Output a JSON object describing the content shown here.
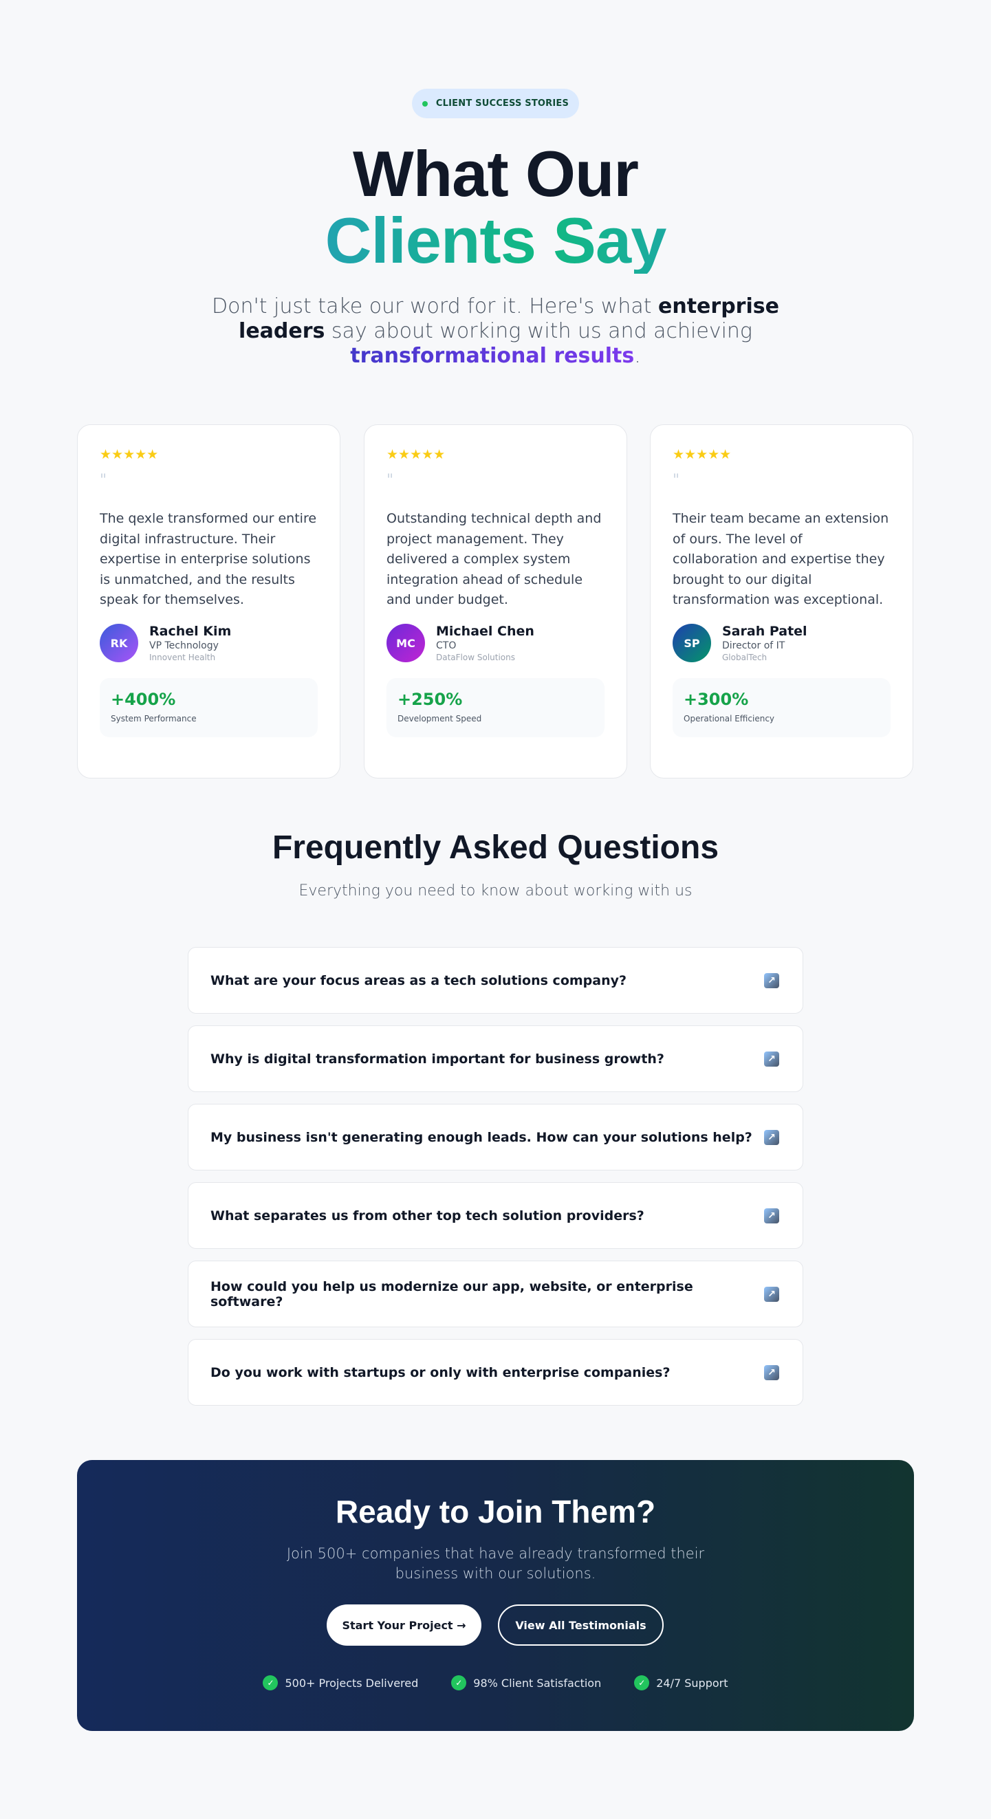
{
  "hero": {
    "badge": "CLIENT SUCCESS STORIES",
    "title_line1": "What Our",
    "title_line2": "Clients Say",
    "subtitle_pre": "Don't just take our word for it. Here's what ",
    "subtitle_strong": "enterprise leaders",
    "subtitle_mid": " say about working with us and achieving ",
    "subtitle_highlight": "transformational results",
    "subtitle_end": "."
  },
  "testimonials": [
    {
      "stars": "★★★★★",
      "quote_mark": "\"",
      "quote": "The qexle transformed our entire digital infrastructure. Their expertise in enterprise solutions is unmatched, and the results speak for themselves.",
      "initials": "RK",
      "name": "Rachel Kim",
      "role": "VP Technology",
      "company": "Innovent Health",
      "metric_value": "+400%",
      "metric_label": "System Performance",
      "avatar_gradient": [
        "#3b5bdb",
        "#a855f7"
      ]
    },
    {
      "stars": "★★★★★",
      "quote_mark": "\"",
      "quote": "Outstanding technical depth and project management. They delivered a complex system integration ahead of schedule and under budget.",
      "initials": "MC",
      "name": "Michael Chen",
      "role": "CTO",
      "company": "DataFlow Solutions",
      "metric_value": "+250%",
      "metric_label": "Development Speed",
      "avatar_gradient": [
        "#6d28d9",
        "#c026d3"
      ]
    },
    {
      "stars": "★★★★★",
      "quote_mark": "\"",
      "quote": "Their team became an extension of ours. The level of collaboration and expertise they brought to our digital transformation was exceptional.",
      "initials": "SP",
      "name": "Sarah Patel",
      "role": "Director of IT",
      "company": "GlobalTech",
      "metric_value": "+300%",
      "metric_label": "Operational Efficiency",
      "avatar_gradient": [
        "#1e40af",
        "#059669"
      ]
    }
  ],
  "faq": {
    "title": "Frequently Asked Questions",
    "subtitle": "Everything you need to know about working with us",
    "toggle_icon": "↗",
    "items": [
      "What are your focus areas as a tech solutions company?",
      "Why is digital transformation important for business growth?",
      "My business isn't generating enough leads. How can your solutions help?",
      "What separates us from other top tech solution providers?",
      "How could you help us modernize our app, website, or enterprise software?",
      "Do you work with startups or only with enterprise companies?"
    ]
  },
  "cta": {
    "title": "Ready to Join Them?",
    "subtitle": "Join 500+ companies that have already transformed their business with our solutions.",
    "primary_button": "Start Your Project →",
    "secondary_button": "View All Testimonials",
    "features": [
      "500+ Projects Delivered",
      "98% Client Satisfaction",
      "24/7 Support"
    ],
    "check_icon": "✓"
  },
  "colors": {
    "accent_green": "#22c55e",
    "metric_green": "#16a34a",
    "star_yellow": "#facc15",
    "cta_background_start": "#152a5a",
    "cta_background_end": "#123430"
  }
}
